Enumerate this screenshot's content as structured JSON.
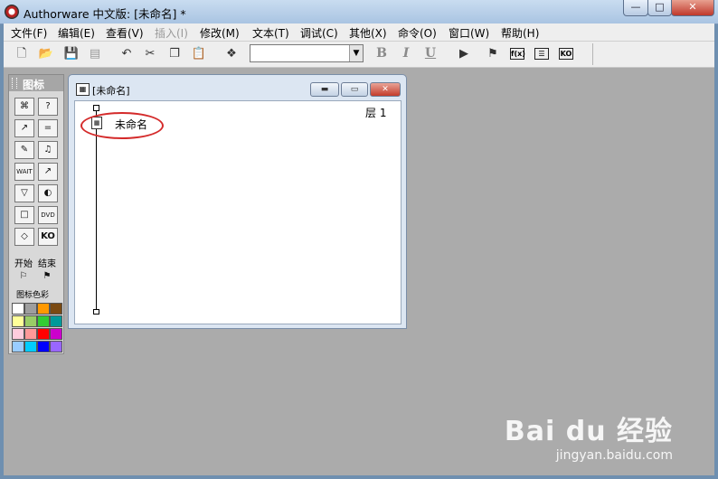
{
  "window": {
    "title": "Authorware 中文版: [未命名] *",
    "min_symbol": "—",
    "max_symbol": "□",
    "close_symbol": "✕"
  },
  "menu": [
    {
      "label": "文件(F)",
      "enabled": true
    },
    {
      "label": "编辑(E)",
      "enabled": true
    },
    {
      "label": "查看(V)",
      "enabled": true
    },
    {
      "label": "插入(I)",
      "enabled": false
    },
    {
      "label": "修改(M)",
      "enabled": true
    },
    {
      "label": "文本(T)",
      "enabled": true
    },
    {
      "label": "调试(C)",
      "enabled": true
    },
    {
      "label": "其他(X)",
      "enabled": true
    },
    {
      "label": "命令(O)",
      "enabled": true
    },
    {
      "label": "窗口(W)",
      "enabled": true
    },
    {
      "label": "帮助(H)",
      "enabled": true
    }
  ],
  "toolbar": {
    "new_icon": "🗋",
    "open_icon": "📂",
    "save_icon": "💾",
    "import_icon": "▤",
    "undo_icon": "↶",
    "cut_icon": "✂",
    "copy_icon": "❐",
    "paste_icon": "📋",
    "find_icon": "❖",
    "style_value": "",
    "style_arrow": "▼",
    "bold": "B",
    "italic": "I",
    "underline": "U",
    "run_icon": "▶",
    "flag_icon": "⚑",
    "fx_label": "f(x)",
    "list_label": "☰",
    "ko_label": "KO"
  },
  "palette": {
    "title": "图标",
    "icons": [
      "⌘",
      "?",
      "↗",
      "=",
      "✎",
      "♫",
      "WAIT",
      "↗",
      "▽",
      "◐",
      "□",
      "DVD",
      "◇",
      "KO"
    ],
    "start_label": "开始",
    "end_label": "结束",
    "start_flag": "⚐",
    "end_flag": "⚑",
    "color_label": "图标色彩",
    "colors": [
      "#ffffff",
      "#9e9e9e",
      "#ff9900",
      "#7a4a12",
      "#ffff99",
      "#99cc66",
      "#33cc33",
      "#009999",
      "#ffccdd",
      "#ff9999",
      "#ff0000",
      "#cc00cc",
      "#99ccff",
      "#00ccff",
      "#0000ff",
      "#9966ff"
    ]
  },
  "flow_window": {
    "title": "[未命名]",
    "level": "层 1",
    "item_label": "未命名",
    "min_symbol": "▬",
    "max_symbol": "▭",
    "close_symbol": "✕"
  },
  "watermark": {
    "logo": "Bai du 经验",
    "url": "jingyan.baidu.com"
  }
}
